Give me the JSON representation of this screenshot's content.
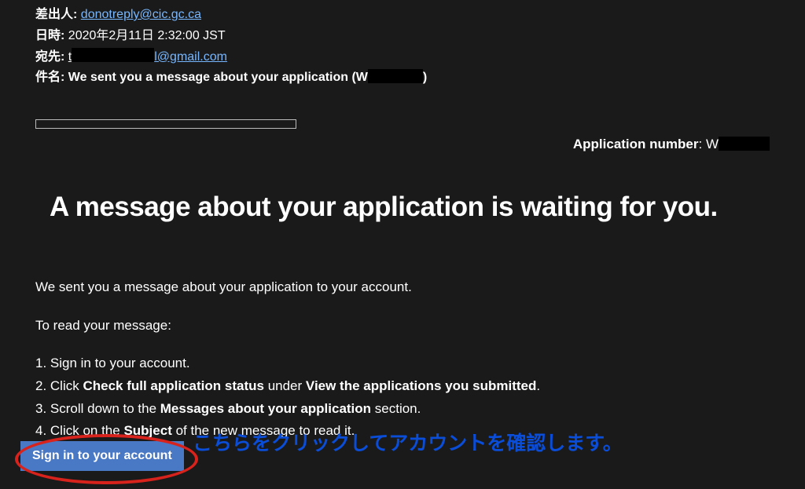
{
  "header": {
    "from_label": "差出人:",
    "from_value": "donotreply@cic.gc.ca",
    "date_label": "日時:",
    "date_value": "2020年2月11日 2:32:00 JST",
    "to_label": "宛先:",
    "to_prefix": "t",
    "to_suffix": "l@gmail.com",
    "subject_label": "件名:",
    "subject_prefix": "We sent you a message about your application (W",
    "subject_suffix": ")"
  },
  "app_number": {
    "label": "Application number",
    "sep": ": W"
  },
  "headline": "A message about your application is waiting for you.",
  "body": {
    "intro": "We sent you a message about your application to your account.",
    "read_label": "To read your message:",
    "steps": {
      "s1": "1. Sign in to your account.",
      "s2a": "2. Click ",
      "s2b": "Check full application status",
      "s2c": " under ",
      "s2d": "View the applications you submitted",
      "s2e": ".",
      "s3a": "3. Scroll down to the ",
      "s3b": "Messages about your application",
      "s3c": " section.",
      "s4a": "4. Click on the ",
      "s4b": "Subject",
      "s4c": " of the new message to read it."
    }
  },
  "annotation": "こちらをクリックしてアカウントを確認します。",
  "button": {
    "label": "Sign in to your account"
  }
}
